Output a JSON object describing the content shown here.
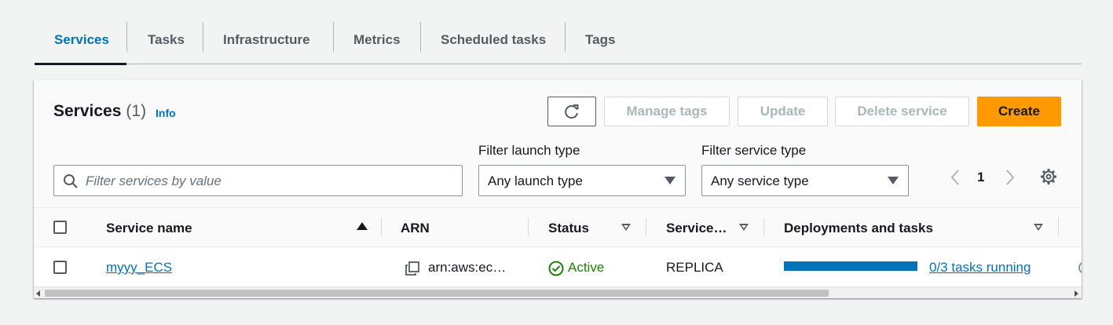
{
  "tabs": {
    "services": "Services",
    "tasks": "Tasks",
    "infrastructure": "Infrastructure",
    "metrics": "Metrics",
    "scheduled_tasks": "Scheduled tasks",
    "tags": "Tags"
  },
  "panel": {
    "title": "Services",
    "count": "(1)",
    "info": "Info"
  },
  "actions": {
    "manage_tags": "Manage tags",
    "update": "Update",
    "delete_service": "Delete service",
    "create": "Create"
  },
  "filters": {
    "search_placeholder": "Filter services by value",
    "launch_type_label": "Filter launch type",
    "launch_type_value": "Any launch type",
    "service_type_label": "Filter service type",
    "service_type_value": "Any service type"
  },
  "pagination": {
    "current_page": "1"
  },
  "table": {
    "headers": {
      "service_name": "Service name",
      "arn": "ARN",
      "status": "Status",
      "service_type": "Service…",
      "deployments": "Deployments and tasks"
    },
    "rows": [
      {
        "service_name": "myyy_ECS",
        "arn": "arn:aws:ec…",
        "status": "Active",
        "service_type": "REPLICA",
        "tasks": "0/3 tasks running",
        "progress": 0
      }
    ]
  },
  "colors": {
    "accent": "#0073bb",
    "primary_button": "#ff9900",
    "success": "#1d8102"
  },
  "icons": [
    "refresh-icon",
    "search-icon",
    "caret-down-icon",
    "chevron-left-icon",
    "chevron-right-icon",
    "gear-icon",
    "sort-ascending-icon",
    "sort-descending-icon",
    "copy-icon",
    "status-success-icon"
  ]
}
